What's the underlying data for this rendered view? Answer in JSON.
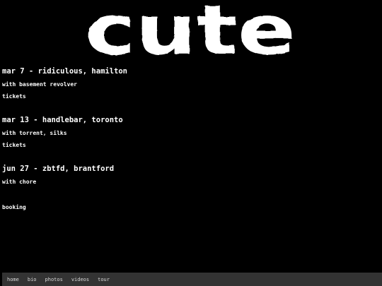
{
  "logo": {
    "text": "cute",
    "color": "#ffffff"
  },
  "shows": [
    {
      "title": "mar 7 - ridiculous, hamilton",
      "with": "with basement revolver",
      "tickets": "tickets"
    },
    {
      "title": "mar 13 - handlebar, toronto",
      "with": "with torrent, silks",
      "tickets": "tickets"
    },
    {
      "title": "jun 27 - zbtfd, brantford",
      "with": "with chore",
      "tickets": ""
    }
  ],
  "booking": "booking",
  "nav": {
    "items": [
      "home",
      "bio",
      "photos",
      "videos",
      "tour"
    ]
  },
  "colors": {
    "background": "#000000",
    "text": "#ffffff",
    "navbar": "#333333",
    "nav_text": "#d8d8d8"
  }
}
